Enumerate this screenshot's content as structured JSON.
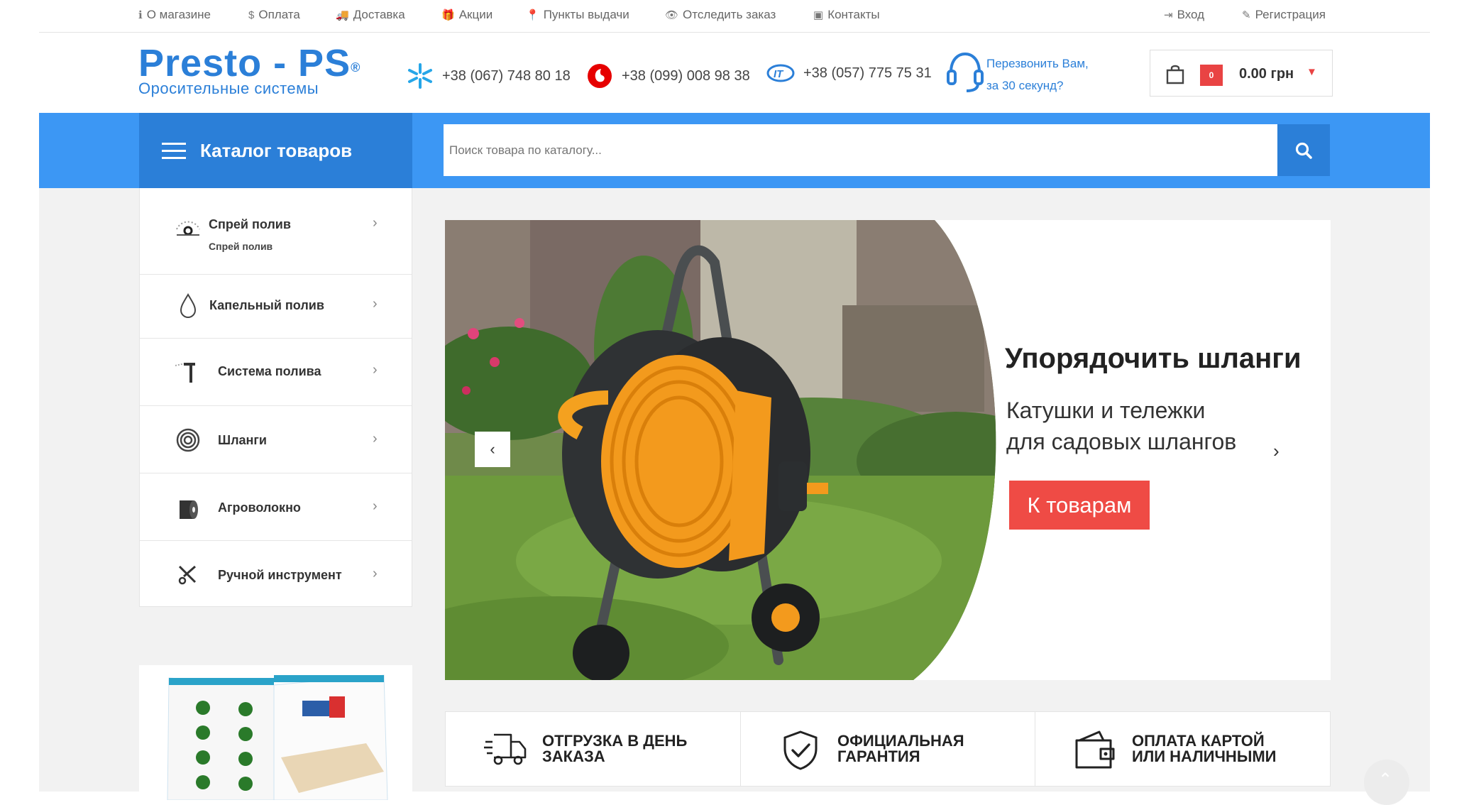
{
  "topnav": {
    "items": [
      {
        "label": "О магазине",
        "icon": "info-icon"
      },
      {
        "label": "Оплата",
        "icon": "dollar-icon"
      },
      {
        "label": "Доставка",
        "icon": "truck-icon"
      },
      {
        "label": "Акции",
        "icon": "gift-icon"
      },
      {
        "label": "Пункты выдачи",
        "icon": "map-marker-icon"
      },
      {
        "label": "Отследить заказ",
        "icon": "eye-icon"
      },
      {
        "label": "Контакты",
        "icon": "contact-card-icon"
      }
    ],
    "login": "Вход",
    "register": "Регистрация"
  },
  "header": {
    "logo_main": "Presto - PS",
    "logo_reg": "®",
    "logo_sub": "Оросительные системы",
    "phones": [
      {
        "number": "+38 (067) 748 80 18",
        "icon": "kyivstar-icon"
      },
      {
        "number": "+38 (099) 008 98 38",
        "icon": "vodafone-icon"
      },
      {
        "number": "+38 (057) 775 75 31",
        "icon": "intertelecom-icon"
      }
    ],
    "callback_line1": "Перезвонить Вам,",
    "callback_line2": "за 30 секунд?",
    "cart_count": "0",
    "cart_total": "0.00 грн"
  },
  "navbar": {
    "catalog_label": "Каталог товаров",
    "search_placeholder": "Поиск товара по каталогу..."
  },
  "sidebar": {
    "items": [
      {
        "label": "Спрей полив",
        "sub": "Спрей полив",
        "icon": "spray-icon"
      },
      {
        "label": "Капельный полив",
        "icon": "drop-icon"
      },
      {
        "label": "Система полива",
        "icon": "sprinkler-icon"
      },
      {
        "label": "Шланги",
        "icon": "hose-icon"
      },
      {
        "label": "Агроволокно",
        "icon": "roll-icon"
      },
      {
        "label": "Ручной инструмент",
        "icon": "tool-icon"
      }
    ]
  },
  "slider": {
    "title": "Упорядочить шланги",
    "subtitle_line1": "Катушки и тележки",
    "subtitle_line2": "для садовых шлангов",
    "cta": "К товарам"
  },
  "features": [
    {
      "line1": "ОТГРУЗКА В ДЕНЬ",
      "line2": "ЗАКАЗА",
      "icon": "delivery-truck-icon"
    },
    {
      "line1": "ОФИЦИАЛЬНАЯ",
      "line2": "ГАРАНТИЯ",
      "icon": "shield-check-icon"
    },
    {
      "line1": "ОПЛАТА КАРТОЙ",
      "line2": "ИЛИ НАЛИЧНЫМИ",
      "icon": "wallet-icon"
    }
  ],
  "colors": {
    "brand_blue": "#2b7fd8",
    "bar_blue": "#3c97f4",
    "accent_red": "#ef4b45"
  }
}
